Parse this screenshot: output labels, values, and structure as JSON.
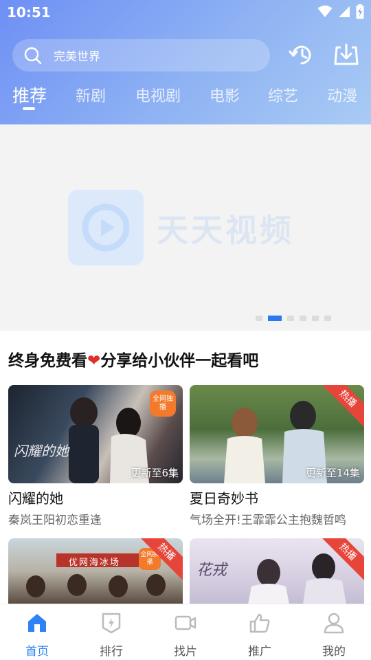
{
  "status_bar": {
    "time": "10:51"
  },
  "search": {
    "text": "完美世界"
  },
  "header_icons": [
    "history-icon",
    "download-icon"
  ],
  "tabs": [
    {
      "label": "推荐",
      "active": true
    },
    {
      "label": "新剧"
    },
    {
      "label": "电视剧"
    },
    {
      "label": "电影"
    },
    {
      "label": "综艺"
    },
    {
      "label": "动漫"
    }
  ],
  "banner": {
    "logo_text": "天天视频",
    "page_count": 6,
    "active_page": 2
  },
  "slogan": {
    "part1": "终身免费看",
    "heart": "❤",
    "part2": "分享给小伙伴一起看吧"
  },
  "cards": [
    {
      "title": "闪耀的她",
      "subtitle": "秦岚王阳初恋重逢",
      "update": "更新至6集",
      "tag": "全网独播",
      "art_text": "闪耀的她"
    },
    {
      "title": "夏日奇妙书",
      "subtitle": "气场全开!王霏霏公主抱魏哲鸣",
      "update": "更新至14集",
      "ribbon": "热播"
    },
    {
      "title": "",
      "subtitle": "",
      "ribbon": "热播",
      "tag": "全网独播",
      "art_text": "优网海冰场"
    },
    {
      "title": "",
      "subtitle": "",
      "ribbon": "热播",
      "art_text": "花戎"
    }
  ],
  "bottom_nav": [
    {
      "label": "首页",
      "icon": "home-icon",
      "active": true
    },
    {
      "label": "排行",
      "icon": "ranking-icon"
    },
    {
      "label": "找片",
      "icon": "video-icon"
    },
    {
      "label": "推广",
      "icon": "thumbs-up-icon"
    },
    {
      "label": "我的",
      "icon": "user-icon"
    }
  ],
  "colors": {
    "accent": "#2e82f6",
    "ribbon": "#e6463a",
    "heart": "#e0302c"
  }
}
